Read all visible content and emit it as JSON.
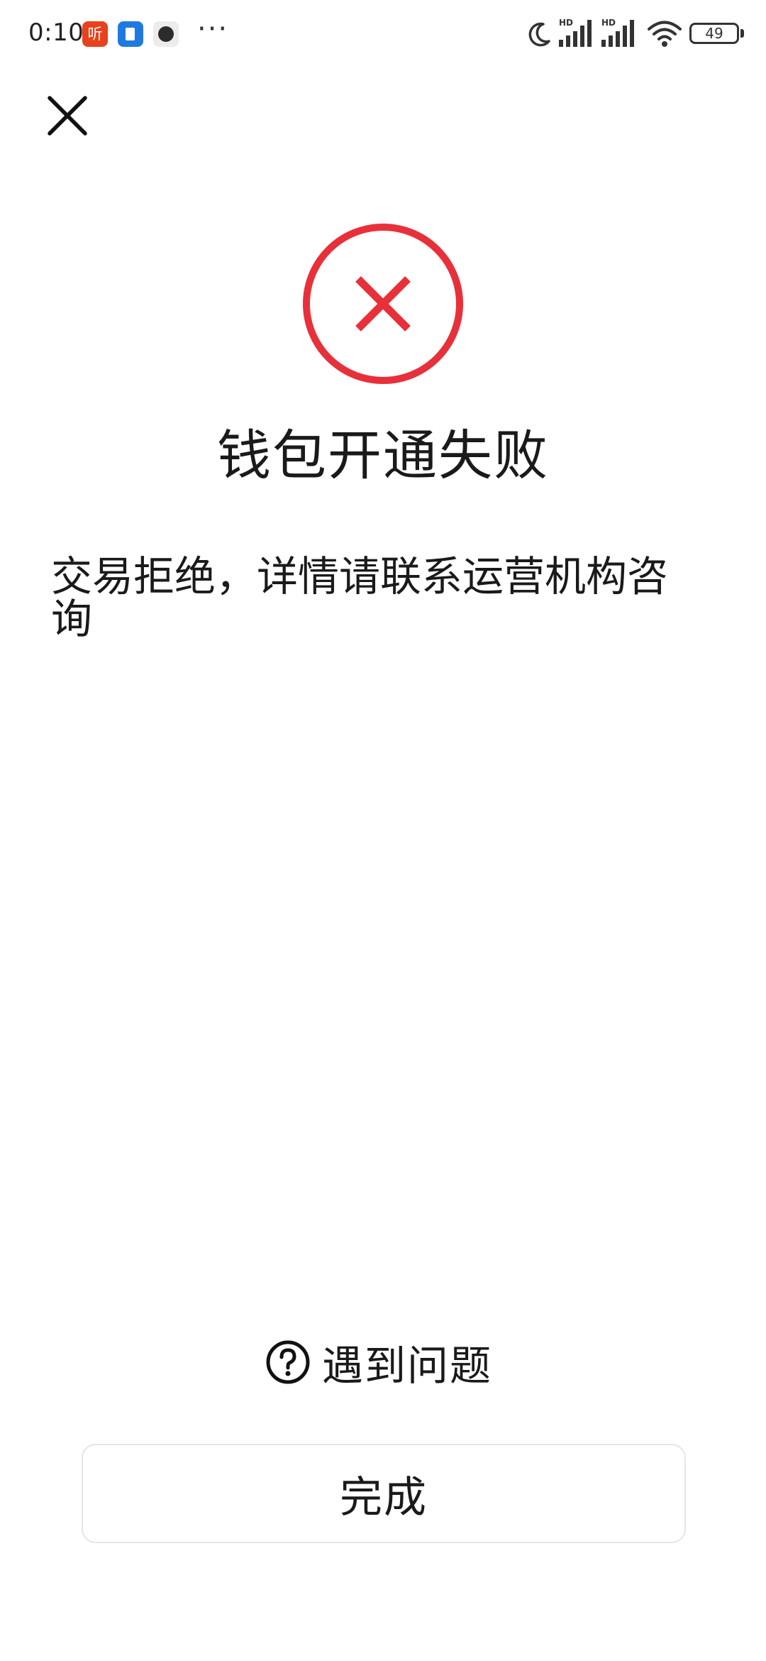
{
  "status_bar": {
    "time": "0:10",
    "notification_app_label": "听",
    "more": "···",
    "hd_label": "HD",
    "battery": "49"
  },
  "header": {
    "close_icon": "close-icon"
  },
  "result": {
    "icon": "error-x-icon",
    "accent_color": "#e8303a",
    "title": "钱包开通失败",
    "message": "交易拒绝，详情请联系运营机构咨询"
  },
  "help": {
    "icon": "question-circle-icon",
    "label": "遇到问题"
  },
  "footer": {
    "done_label": "完成"
  }
}
